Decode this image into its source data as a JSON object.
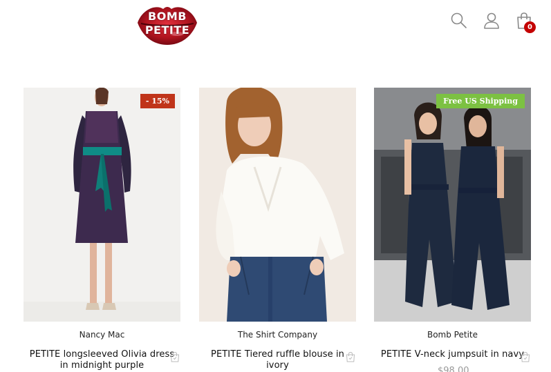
{
  "header": {
    "logo_line1": "BOMB",
    "logo_line2": "PETITE",
    "cart_count": "0",
    "icons": [
      "search-icon",
      "user-icon",
      "shopping-bag-icon"
    ]
  },
  "products": [
    {
      "brand": "Nancy Mac",
      "title": "PETITE longsleeved Olivia dress in midnight purple",
      "badge": "- 15%"
    },
    {
      "brand": "The Shirt Company",
      "title": "PETITE Tiered ruffle blouse in ivory"
    },
    {
      "brand": "Bomb Petite",
      "title": "PETITE V-neck jumpsuit in navy",
      "badge": "Free US Shipping",
      "price": "$98.00"
    }
  ],
  "colors": {
    "brand_red": "#c40000",
    "sale_badge": "#c0341a",
    "shipping_badge": "#7cc142"
  }
}
